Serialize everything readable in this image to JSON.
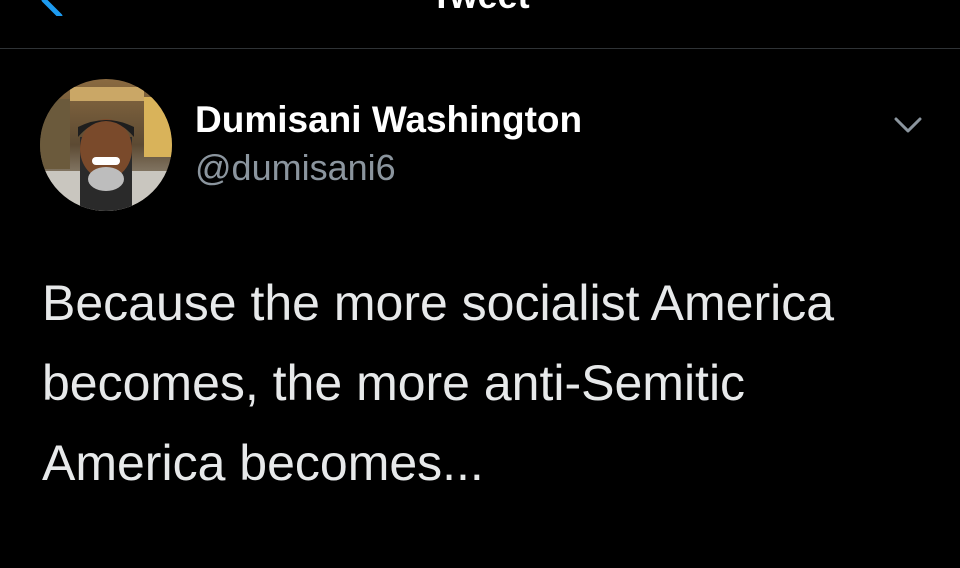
{
  "header": {
    "title": "Tweet",
    "back_icon": "chevron-left-icon",
    "accent_color": "#1d9bf0"
  },
  "tweet": {
    "author": {
      "display_name": "Dumisani Washington",
      "handle": "@dumisani6",
      "avatar_icon": "avatar"
    },
    "menu_icon": "chevron-down-icon",
    "text_lines": [
      "Because the more socialist America",
      "becomes, the more anti-Semitic",
      "America becomes..."
    ]
  },
  "colors": {
    "background": "#000000",
    "text": "#e7e9ea",
    "secondary_text": "#8b959e",
    "divider": "#2f3336"
  }
}
